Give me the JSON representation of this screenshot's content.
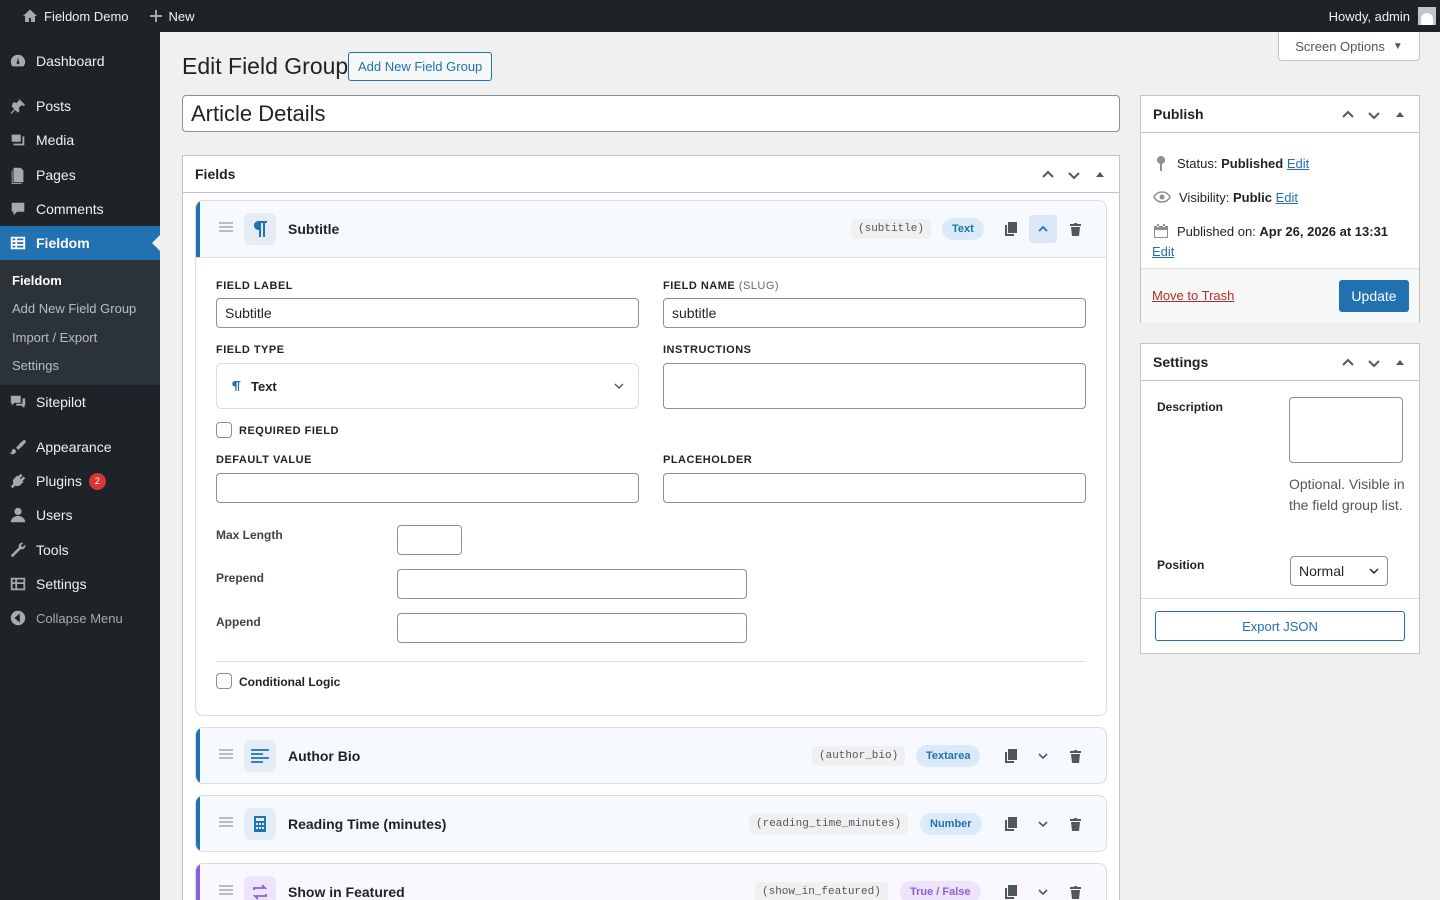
{
  "admin_bar": {
    "site_name": "Fieldom Demo",
    "new_label": "New",
    "howdy": "Howdy, admin"
  },
  "sidebar": {
    "items": [
      {
        "label": "Dashboard",
        "icon": "dashboard-icon"
      },
      {
        "label": "Posts",
        "icon": "pin-icon"
      },
      {
        "label": "Media",
        "icon": "media-icon"
      },
      {
        "label": "Pages",
        "icon": "pages-icon"
      },
      {
        "label": "Comments",
        "icon": "comments-icon"
      },
      {
        "label": "Fieldom",
        "icon": "table-icon"
      },
      {
        "label": "Sitepilot",
        "icon": "sitepilot-icon"
      },
      {
        "label": "Appearance",
        "icon": "brush-icon"
      },
      {
        "label": "Plugins",
        "icon": "plugin-icon",
        "badge": "2"
      },
      {
        "label": "Users",
        "icon": "users-icon"
      },
      {
        "label": "Tools",
        "icon": "wrench-icon"
      },
      {
        "label": "Settings",
        "icon": "settings-icon"
      }
    ],
    "submenu": [
      "Fieldom",
      "Add New Field Group",
      "Import / Export",
      "Settings"
    ],
    "collapse": "Collapse Menu"
  },
  "screen_options": "Screen Options",
  "page": {
    "title": "Edit Field Group",
    "add_new": "Add New Field Group",
    "group_title": "Article Details"
  },
  "fields_box": {
    "title": "Fields",
    "fields": [
      {
        "label": "Subtitle",
        "slug": "(subtitle)",
        "type": "Text",
        "icon": "paragraph-icon"
      },
      {
        "label": "Author Bio",
        "slug": "(author_bio)",
        "type": "Textarea",
        "icon": "textarea-icon"
      },
      {
        "label": "Reading Time (minutes)",
        "slug": "(reading_time_minutes)",
        "type": "Number",
        "icon": "calculator-icon"
      },
      {
        "label": "Show in Featured",
        "slug": "(show_in_featured)",
        "type": "True / False",
        "icon": "toggle-icon"
      }
    ],
    "editor": {
      "field_label_lbl": "Field Label",
      "field_label_val": "Subtitle",
      "field_name_lbl": "Field Name",
      "field_name_sub": "(slug)",
      "field_name_val": "subtitle",
      "field_type_lbl": "Field Type",
      "field_type_val": "Text",
      "instructions_lbl": "Instructions",
      "required_lbl": "Required Field",
      "default_lbl": "Default Value",
      "placeholder_lbl": "Placeholder",
      "maxlength_lbl": "Max Length",
      "prepend_lbl": "Prepend",
      "append_lbl": "Append",
      "conditional_lbl": "Conditional Logic"
    }
  },
  "publish": {
    "title": "Publish",
    "status_lbl": "Status:",
    "status_val": "Published",
    "visibility_lbl": "Visibility:",
    "visibility_val": "Public",
    "published_lbl": "Published on:",
    "published_val": "Apr 26, 2026 at 13:31",
    "edit": "Edit",
    "trash": "Move to Trash",
    "update": "Update"
  },
  "settings": {
    "title": "Settings",
    "description_lbl": "Description",
    "description_help": "Optional. Visible in the field group list.",
    "position_lbl": "Position",
    "position_val": "Normal",
    "export": "Export JSON"
  },
  "colors": {
    "accent": "#2271b1",
    "sidebar": "#1d2327",
    "purple": "#8c5ee0",
    "danger": "#d63638"
  }
}
